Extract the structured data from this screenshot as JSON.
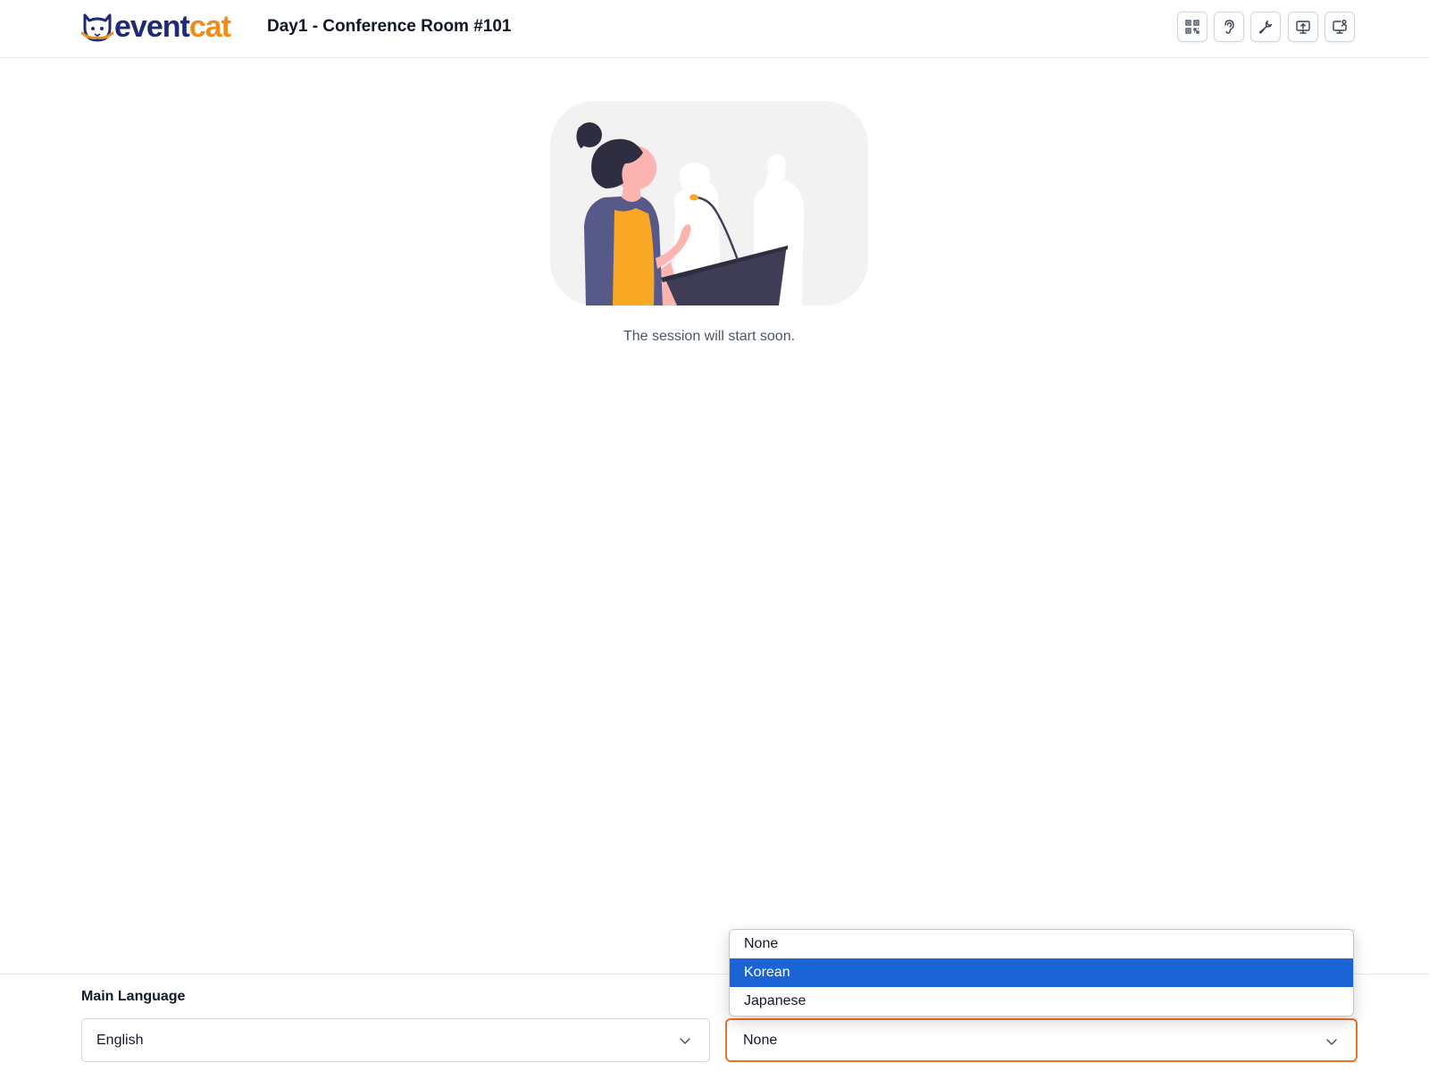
{
  "header": {
    "logo_text_part1": "event",
    "logo_text_part2": "cat",
    "room_title": "Day1 - Conference Room #101",
    "tools": [
      {
        "icon": "qr-code-icon"
      },
      {
        "icon": "ear-icon"
      },
      {
        "icon": "wrench-icon"
      },
      {
        "icon": "screen-share-icon"
      },
      {
        "icon": "monitor-user-icon"
      }
    ]
  },
  "main": {
    "status_message": "The session will start soon."
  },
  "footer": {
    "main_language_label": "Main Language",
    "main_language_value": "English",
    "secondary_language_value": "None",
    "dropdown_options": [
      "None",
      "Korean",
      "Japanese"
    ],
    "highlighted_option": "Korean"
  },
  "colors": {
    "brand_navy": "#1e2a78",
    "brand_orange": "#f08c1c",
    "focus_border": "#e8742a",
    "option_highlight": "#1a64d6"
  }
}
